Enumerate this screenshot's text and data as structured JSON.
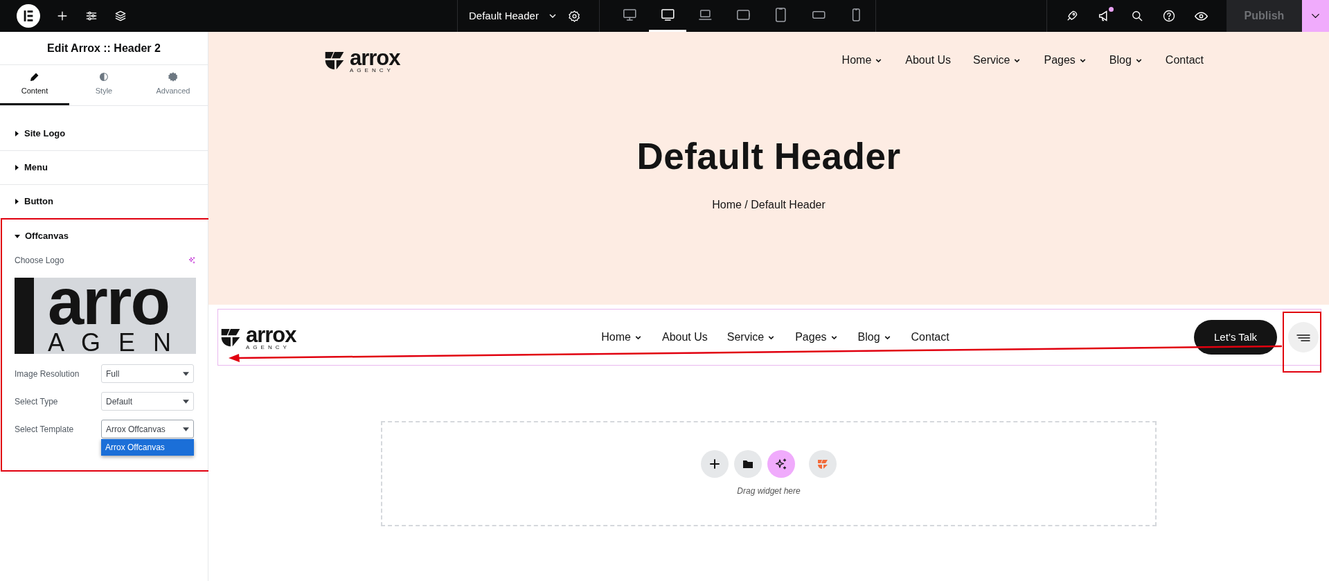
{
  "topbar": {
    "document_title": "Default Header",
    "devices": [
      {
        "selected": false
      },
      {
        "selected": true
      },
      {
        "selected": false
      },
      {
        "selected": false
      },
      {
        "selected": false
      },
      {
        "selected": false
      },
      {
        "selected": false
      }
    ],
    "notification": true,
    "publish": "Publish"
  },
  "panel": {
    "title": "Edit Arrox :: Header 2",
    "tabs": [
      {
        "label": "Content",
        "selected": true
      },
      {
        "label": "Style",
        "selected": false
      },
      {
        "label": "Advanced",
        "selected": false
      }
    ],
    "sections": [
      {
        "label": "Site Logo",
        "expanded": false
      },
      {
        "label": "Menu",
        "expanded": false
      },
      {
        "label": "Button",
        "expanded": false
      },
      {
        "label": "Offcanvas",
        "expanded": true
      }
    ],
    "offcanvas": {
      "logo_label": "Choose Logo",
      "logo_preview": {
        "text": "arro",
        "subtext": "A G E N"
      },
      "fields": [
        {
          "label": "Image Resolution",
          "value": "Full",
          "open": false
        },
        {
          "label": "Select Type",
          "value": "Default",
          "open": false
        },
        {
          "label": "Select Template",
          "value": "Arrox Offcanvas",
          "open": true,
          "options": [
            {
              "label": "Arrox Offcanvas",
              "selected": true
            }
          ]
        }
      ]
    }
  },
  "header_1": {
    "logo": {
      "name": "arrox",
      "tagline": "AGENCY"
    },
    "nav": [
      {
        "label": "Home",
        "dropdown": true
      },
      {
        "label": "About Us",
        "dropdown": false
      },
      {
        "label": "Service",
        "dropdown": true
      },
      {
        "label": "Pages",
        "dropdown": true
      },
      {
        "label": "Blog",
        "dropdown": true
      },
      {
        "label": "Contact",
        "dropdown": false
      }
    ],
    "title": "Default Header",
    "breadcrumb": "Home / Default Header"
  },
  "header_2": {
    "logo": {
      "name": "arrox",
      "tagline": "AGENCY"
    },
    "nav": [
      {
        "label": "Home",
        "dropdown": true
      },
      {
        "label": "About Us",
        "dropdown": false
      },
      {
        "label": "Service",
        "dropdown": true
      },
      {
        "label": "Pages",
        "dropdown": true
      },
      {
        "label": "Blog",
        "dropdown": true
      },
      {
        "label": "Contact",
        "dropdown": false
      }
    ],
    "button": "Let’s Talk"
  },
  "drop_area": {
    "hint": "Drag widget here"
  }
}
